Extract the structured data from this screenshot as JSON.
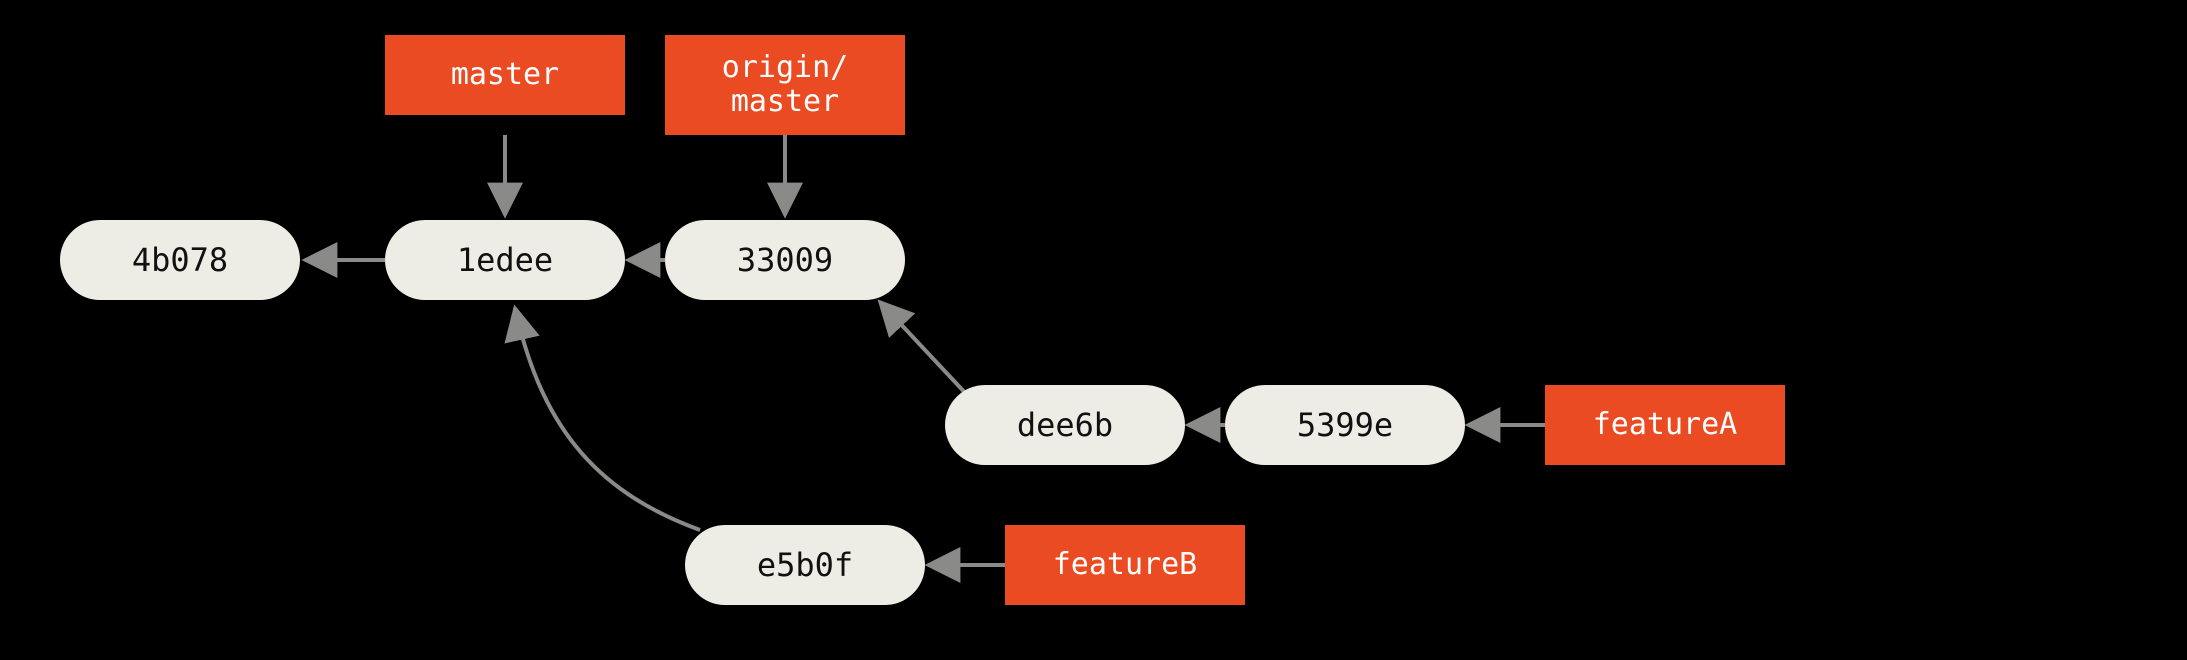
{
  "commits": {
    "c1": "4b078",
    "c2": "1edee",
    "c3": "33009",
    "c4": "dee6b",
    "c5": "5399e",
    "c6": "e5b0f"
  },
  "branches": {
    "master": "master",
    "origin_master": "origin/\nmaster",
    "featureA": "featureA",
    "featureB": "featureB"
  }
}
